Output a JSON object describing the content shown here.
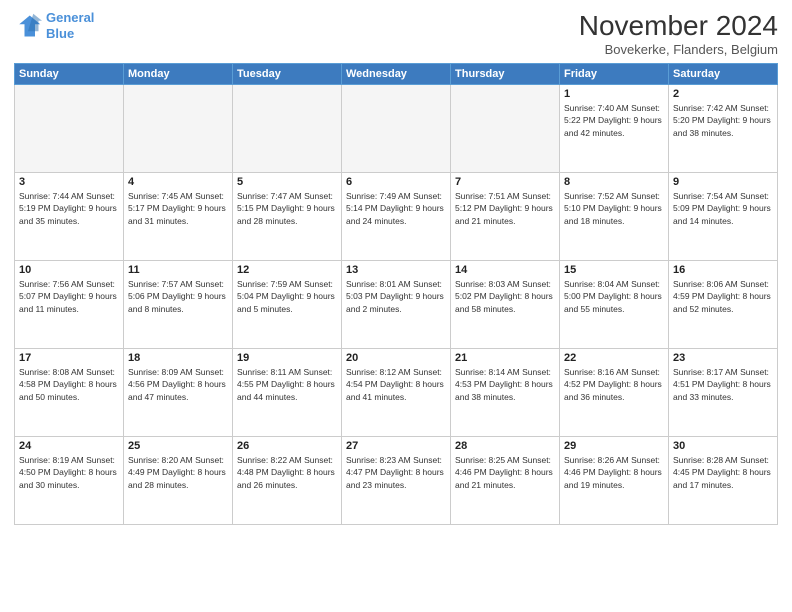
{
  "header": {
    "logo_line1": "General",
    "logo_line2": "Blue",
    "month": "November 2024",
    "location": "Bovekerke, Flanders, Belgium"
  },
  "weekdays": [
    "Sunday",
    "Monday",
    "Tuesday",
    "Wednesday",
    "Thursday",
    "Friday",
    "Saturday"
  ],
  "days": [
    {
      "num": "",
      "info": ""
    },
    {
      "num": "",
      "info": ""
    },
    {
      "num": "",
      "info": ""
    },
    {
      "num": "",
      "info": ""
    },
    {
      "num": "",
      "info": ""
    },
    {
      "num": "1",
      "info": "Sunrise: 7:40 AM\nSunset: 5:22 PM\nDaylight: 9 hours\nand 42 minutes."
    },
    {
      "num": "2",
      "info": "Sunrise: 7:42 AM\nSunset: 5:20 PM\nDaylight: 9 hours\nand 38 minutes."
    },
    {
      "num": "3",
      "info": "Sunrise: 7:44 AM\nSunset: 5:19 PM\nDaylight: 9 hours\nand 35 minutes."
    },
    {
      "num": "4",
      "info": "Sunrise: 7:45 AM\nSunset: 5:17 PM\nDaylight: 9 hours\nand 31 minutes."
    },
    {
      "num": "5",
      "info": "Sunrise: 7:47 AM\nSunset: 5:15 PM\nDaylight: 9 hours\nand 28 minutes."
    },
    {
      "num": "6",
      "info": "Sunrise: 7:49 AM\nSunset: 5:14 PM\nDaylight: 9 hours\nand 24 minutes."
    },
    {
      "num": "7",
      "info": "Sunrise: 7:51 AM\nSunset: 5:12 PM\nDaylight: 9 hours\nand 21 minutes."
    },
    {
      "num": "8",
      "info": "Sunrise: 7:52 AM\nSunset: 5:10 PM\nDaylight: 9 hours\nand 18 minutes."
    },
    {
      "num": "9",
      "info": "Sunrise: 7:54 AM\nSunset: 5:09 PM\nDaylight: 9 hours\nand 14 minutes."
    },
    {
      "num": "10",
      "info": "Sunrise: 7:56 AM\nSunset: 5:07 PM\nDaylight: 9 hours\nand 11 minutes."
    },
    {
      "num": "11",
      "info": "Sunrise: 7:57 AM\nSunset: 5:06 PM\nDaylight: 9 hours\nand 8 minutes."
    },
    {
      "num": "12",
      "info": "Sunrise: 7:59 AM\nSunset: 5:04 PM\nDaylight: 9 hours\nand 5 minutes."
    },
    {
      "num": "13",
      "info": "Sunrise: 8:01 AM\nSunset: 5:03 PM\nDaylight: 9 hours\nand 2 minutes."
    },
    {
      "num": "14",
      "info": "Sunrise: 8:03 AM\nSunset: 5:02 PM\nDaylight: 8 hours\nand 58 minutes."
    },
    {
      "num": "15",
      "info": "Sunrise: 8:04 AM\nSunset: 5:00 PM\nDaylight: 8 hours\nand 55 minutes."
    },
    {
      "num": "16",
      "info": "Sunrise: 8:06 AM\nSunset: 4:59 PM\nDaylight: 8 hours\nand 52 minutes."
    },
    {
      "num": "17",
      "info": "Sunrise: 8:08 AM\nSunset: 4:58 PM\nDaylight: 8 hours\nand 50 minutes."
    },
    {
      "num": "18",
      "info": "Sunrise: 8:09 AM\nSunset: 4:56 PM\nDaylight: 8 hours\nand 47 minutes."
    },
    {
      "num": "19",
      "info": "Sunrise: 8:11 AM\nSunset: 4:55 PM\nDaylight: 8 hours\nand 44 minutes."
    },
    {
      "num": "20",
      "info": "Sunrise: 8:12 AM\nSunset: 4:54 PM\nDaylight: 8 hours\nand 41 minutes."
    },
    {
      "num": "21",
      "info": "Sunrise: 8:14 AM\nSunset: 4:53 PM\nDaylight: 8 hours\nand 38 minutes."
    },
    {
      "num": "22",
      "info": "Sunrise: 8:16 AM\nSunset: 4:52 PM\nDaylight: 8 hours\nand 36 minutes."
    },
    {
      "num": "23",
      "info": "Sunrise: 8:17 AM\nSunset: 4:51 PM\nDaylight: 8 hours\nand 33 minutes."
    },
    {
      "num": "24",
      "info": "Sunrise: 8:19 AM\nSunset: 4:50 PM\nDaylight: 8 hours\nand 30 minutes."
    },
    {
      "num": "25",
      "info": "Sunrise: 8:20 AM\nSunset: 4:49 PM\nDaylight: 8 hours\nand 28 minutes."
    },
    {
      "num": "26",
      "info": "Sunrise: 8:22 AM\nSunset: 4:48 PM\nDaylight: 8 hours\nand 26 minutes."
    },
    {
      "num": "27",
      "info": "Sunrise: 8:23 AM\nSunset: 4:47 PM\nDaylight: 8 hours\nand 23 minutes."
    },
    {
      "num": "28",
      "info": "Sunrise: 8:25 AM\nSunset: 4:46 PM\nDaylight: 8 hours\nand 21 minutes."
    },
    {
      "num": "29",
      "info": "Sunrise: 8:26 AM\nSunset: 4:46 PM\nDaylight: 8 hours\nand 19 minutes."
    },
    {
      "num": "30",
      "info": "Sunrise: 8:28 AM\nSunset: 4:45 PM\nDaylight: 8 hours\nand 17 minutes."
    }
  ]
}
